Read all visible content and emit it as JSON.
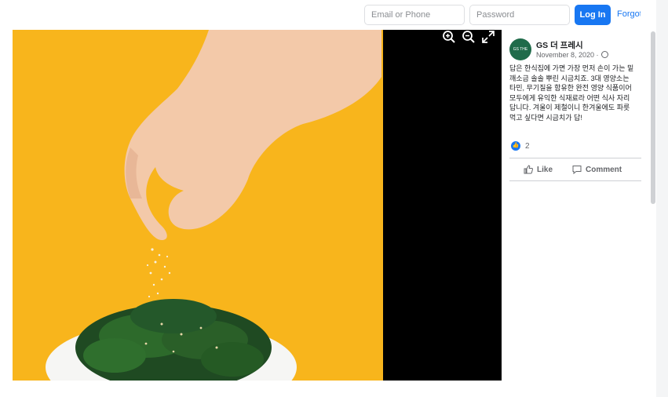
{
  "header": {
    "email_placeholder": "Email or Phone",
    "password_placeholder": "Password",
    "login_label": "Log In",
    "forgot_label": "Forgot"
  },
  "photo": {
    "controls": [
      "zoom-in-icon",
      "zoom-out-icon",
      "fullscreen-icon"
    ],
    "background_color": "#f8b51c"
  },
  "post": {
    "page_name": "GS 더 프레시",
    "avatar_text": "GS THE FRESH",
    "date": "November 8, 2020 ·",
    "text_lines": [
      "답은 한식집에 가면 가장 먼저 손이 가는 밑",
      "깨소금 솔솔 뿌린 시금치죠. 3대 영양소는",
      "타민, 무기질을 함유한 완전 영양 식품이어",
      "모두에게 유익한 식재료라 어떤 식사 자리",
      "답니다. 겨울이 제철이니 한겨울에도 파릇",
      "먹고 싶다면 시금치가 답!"
    ],
    "reaction_count": "2",
    "like_label": "Like",
    "comment_label": "Comment"
  },
  "colors": {
    "accent": "#1877f2",
    "avatar_bg": "#1f6b4a"
  }
}
